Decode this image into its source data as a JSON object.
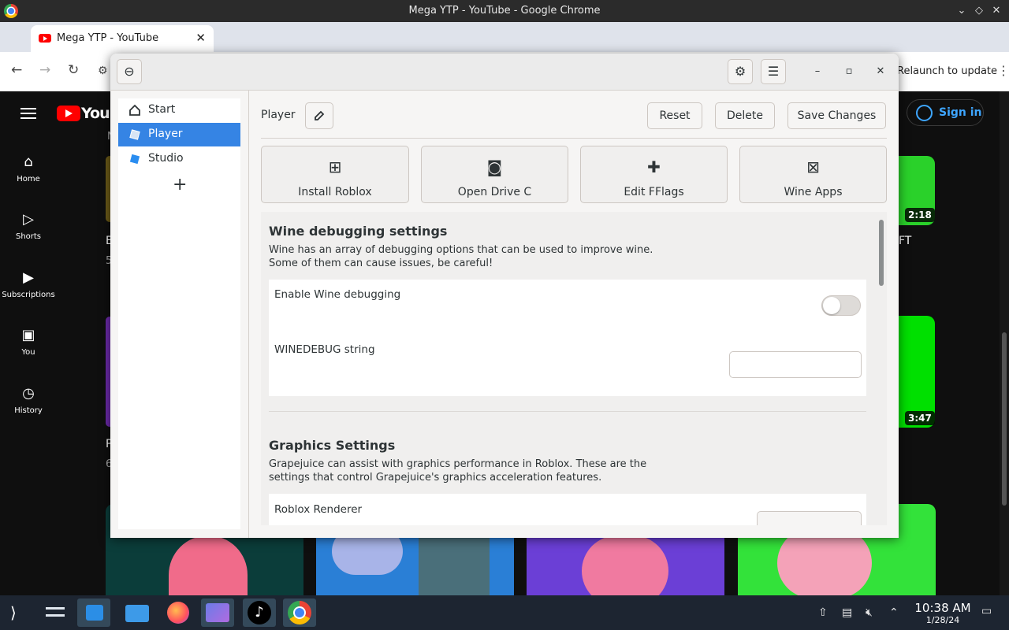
{
  "browser": {
    "window_title": "Mega YTP - YouTube - Google Chrome",
    "tab_title": "Mega YTP - YouTube",
    "relaunch_label": "Relaunch to update"
  },
  "youtube": {
    "logo_text": "YouTube",
    "sidebar": [
      {
        "label": "Home",
        "icon": "home-icon"
      },
      {
        "label": "Shorts",
        "icon": "shorts-icon"
      },
      {
        "label": "Subscriptions",
        "icon": "subscriptions-icon"
      },
      {
        "label": "You",
        "icon": "you-icon"
      },
      {
        "label": "History",
        "icon": "history-icon"
      }
    ],
    "sign_in": "Sign in",
    "durations": [
      "2:18",
      "3:47"
    ],
    "fragments": [
      "FT",
      "E",
      "5",
      "P",
      "6",
      "N"
    ],
    "colors": {
      "accent": "#ff0000",
      "link": "#3ea6ff"
    }
  },
  "grapejuice": {
    "sidebar_items": [
      {
        "label": "Start",
        "icon": "home-icon"
      },
      {
        "label": "Player",
        "icon": "roblox-player-icon"
      },
      {
        "label": "Studio",
        "icon": "roblox-studio-icon"
      }
    ],
    "add_label": "+",
    "page_label": "Player",
    "buttons": {
      "reset": "Reset",
      "delete": "Delete",
      "save": "Save Changes"
    },
    "actions": [
      {
        "label": "Install Roblox",
        "icon": "package-icon"
      },
      {
        "label": "Open Drive C",
        "icon": "drive-icon"
      },
      {
        "label": "Edit FFlags",
        "icon": "puzzle-icon"
      },
      {
        "label": "Wine Apps",
        "icon": "wine-apps-icon"
      }
    ],
    "wine_section": {
      "title": "Wine debugging settings",
      "desc_line1": "Wine has an array of debugging options that can be used to improve wine.",
      "desc_line2": "Some of them can cause issues, be careful!",
      "enable_label": "Enable Wine debugging",
      "enable_value": false,
      "winedebug_label": "WINEDEBUG string",
      "winedebug_value": ""
    },
    "graphics_section": {
      "title": "Graphics Settings",
      "desc_line1": "Grapejuice can assist with graphics performance in Roblox. These are the",
      "desc_line2": "settings that control Grapejuice's graphics acceleration features.",
      "renderer_label": "Roblox Renderer"
    },
    "colors": {
      "selected": "#3584e4"
    }
  },
  "taskbar": {
    "time": "10:38 AM",
    "date": "1/28/24"
  }
}
